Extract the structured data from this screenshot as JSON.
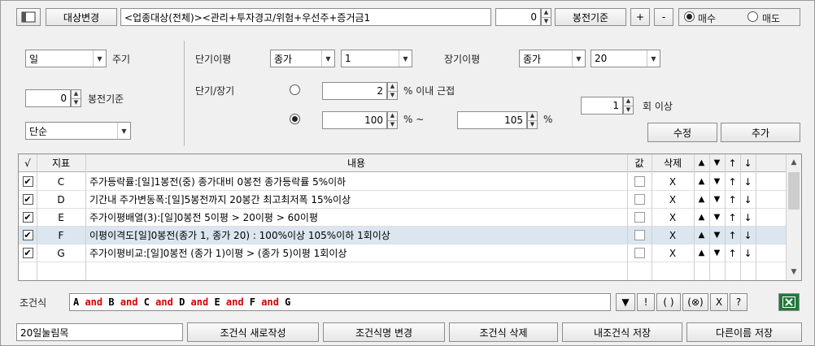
{
  "top": {
    "target_change_label": "대상변경",
    "target_text": "<업종대상(전체)><관리+투자경고/위험+우선주+증거금1",
    "bong_value": "0",
    "bong_label": "봉전기준",
    "plus_label": "+",
    "minus_label": "-",
    "buy_label": "매수",
    "sell_label": "매도",
    "buy_selected": true
  },
  "left": {
    "period_value": "일",
    "period_label": "주기",
    "bong_value": "0",
    "bong_label": "봉전기준",
    "mode_value": "단순"
  },
  "ma": {
    "short_label": "단기이평",
    "short_price": "종가",
    "short_period": "1",
    "long_label": "장기이평",
    "long_price": "종가",
    "long_period": "20",
    "short_long_label": "단기/장기",
    "near_value": "2",
    "near_label": "% 이내 근접",
    "range_from": "100",
    "range_sep": "% ~",
    "range_to": "105",
    "range_pct": "%",
    "count_value": "1",
    "count_label": "회 이상",
    "modify_label": "수정",
    "add_label": "추가",
    "radio_near_selected": false,
    "radio_range_selected": true
  },
  "grid": {
    "headers": {
      "check": "√",
      "indicator": "지표",
      "content": "내용",
      "value": "값",
      "delete": "삭제",
      "up": "▲",
      "down": "▼",
      "top": "↑",
      "bottom": "↓"
    },
    "rows": [
      {
        "checked": true,
        "id": "C",
        "content": "주가등락률:[일]1봉전(중) 종가대비 0봉전 종가등락률 5%이하",
        "del": "X",
        "up": "▲",
        "down": "▼",
        "top": "↑",
        "bottom": "↓",
        "selected": false
      },
      {
        "checked": true,
        "id": "D",
        "content": "기간내 주가변동폭:[일]5봉전까지 20봉간 최고최저폭 15%이상",
        "del": "X",
        "up": "▲",
        "down": "▼",
        "top": "↑",
        "bottom": "↓",
        "selected": false
      },
      {
        "checked": true,
        "id": "E",
        "content": "주가이평배열(3):[일]0봉전 5이평 > 20이평 > 60이평",
        "del": "X",
        "up": "▲",
        "down": "▼",
        "top": "↑",
        "bottom": "↓",
        "selected": false
      },
      {
        "checked": true,
        "id": "F",
        "content": "이평이격도[일]0봉전(종가 1, 종가 20) : 100%이상 105%이하 1회이상",
        "del": "X",
        "up": "▲",
        "down": "▼",
        "top": "↑",
        "bottom": "↓",
        "selected": true
      },
      {
        "checked": true,
        "id": "G",
        "content": "주가이평비교:[일]0봉전 (종가 1)이평 > (종가 5)이평 1회이상",
        "del": "X",
        "up": "▲",
        "down": "▼",
        "top": "↑",
        "bottom": "↓",
        "selected": false
      }
    ]
  },
  "condition": {
    "label": "조건식",
    "tokens": [
      {
        "t": "A",
        "op": false
      },
      {
        "t": " and ",
        "op": true
      },
      {
        "t": "B",
        "op": false
      },
      {
        "t": " and ",
        "op": true
      },
      {
        "t": "C",
        "op": false
      },
      {
        "t": " and ",
        "op": true
      },
      {
        "t": "D",
        "op": false
      },
      {
        "t": " and ",
        "op": true
      },
      {
        "t": "E",
        "op": false
      },
      {
        "t": " and ",
        "op": true
      },
      {
        "t": "F",
        "op": false
      },
      {
        "t": " and ",
        "op": true
      },
      {
        "t": "G",
        "op": false
      }
    ],
    "ops": [
      "▼",
      "!",
      "( )",
      "(⊗)",
      "X",
      "?"
    ]
  },
  "bottom": {
    "name_value": "20일눌림목",
    "new_label": "조건식 새로작성",
    "rename_label": "조건식명 변경",
    "delete_label": "조건식 삭제",
    "save_label": "내조건식 저장",
    "save_as_label": "다른이름 저장"
  }
}
